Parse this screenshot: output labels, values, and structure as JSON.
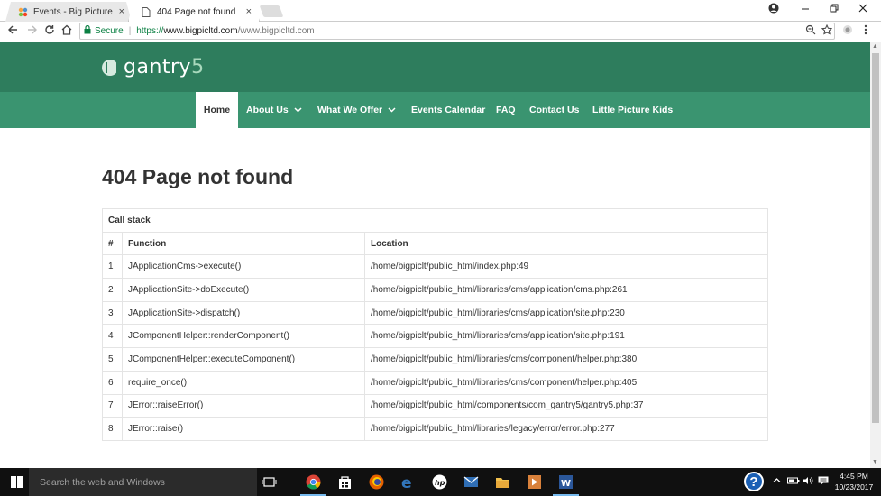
{
  "browser": {
    "tabs": [
      {
        "title": "Events - Big Picture Ltd.",
        "active": false
      },
      {
        "title": "404 Page not found",
        "active": true
      }
    ],
    "close_glyph": "×",
    "address": {
      "secure_label": "Secure",
      "url_proto": "https://",
      "url_host": "www.bigpicltd.com",
      "url_path": "/www.bigpicltd.com"
    }
  },
  "site": {
    "logo_text": "gantry",
    "logo_suffix": "5",
    "nav": [
      {
        "label": "Home",
        "active": true,
        "has_dropdown": false
      },
      {
        "label": "About Us",
        "active": false,
        "has_dropdown": true
      },
      {
        "label": "What We Offer",
        "active": false,
        "has_dropdown": true
      },
      {
        "label": "Events Calendar",
        "active": false,
        "has_dropdown": false
      },
      {
        "label": "FAQ",
        "active": false,
        "has_dropdown": false
      },
      {
        "label": "Contact Us",
        "active": false,
        "has_dropdown": false
      },
      {
        "label": "Little Picture Kids",
        "active": false,
        "has_dropdown": false
      }
    ],
    "colors": {
      "header": "#2e7d5d",
      "nav": "#3a9470"
    }
  },
  "error": {
    "title": "404 Page not found",
    "stack_caption": "Call stack",
    "columns": [
      "#",
      "Function",
      "Location"
    ],
    "rows": [
      {
        "n": "1",
        "fn": "JApplicationCms->execute()",
        "loc": "/home/bigpiclt/public_html/index.php:49"
      },
      {
        "n": "2",
        "fn": "JApplicationSite->doExecute()",
        "loc": "/home/bigpiclt/public_html/libraries/cms/application/cms.php:261"
      },
      {
        "n": "3",
        "fn": "JApplicationSite->dispatch()",
        "loc": "/home/bigpiclt/public_html/libraries/cms/application/site.php:230"
      },
      {
        "n": "4",
        "fn": "JComponentHelper::renderComponent()",
        "loc": "/home/bigpiclt/public_html/libraries/cms/application/site.php:191"
      },
      {
        "n": "5",
        "fn": "JComponentHelper::executeComponent()",
        "loc": "/home/bigpiclt/public_html/libraries/cms/component/helper.php:380"
      },
      {
        "n": "6",
        "fn": "require_once()",
        "loc": "/home/bigpiclt/public_html/libraries/cms/component/helper.php:405"
      },
      {
        "n": "7",
        "fn": "JError::raiseError()",
        "loc": "/home/bigpiclt/public_html/components/com_gantry5/gantry5.php:37"
      },
      {
        "n": "8",
        "fn": "JError::raise()",
        "loc": "/home/bigpiclt/public_html/libraries/legacy/error/error.php:277"
      }
    ]
  },
  "taskbar": {
    "search_placeholder": "Search the web and Windows",
    "help_glyph": "?",
    "clock_time": "4:45 PM",
    "clock_date": "10/23/2017"
  }
}
